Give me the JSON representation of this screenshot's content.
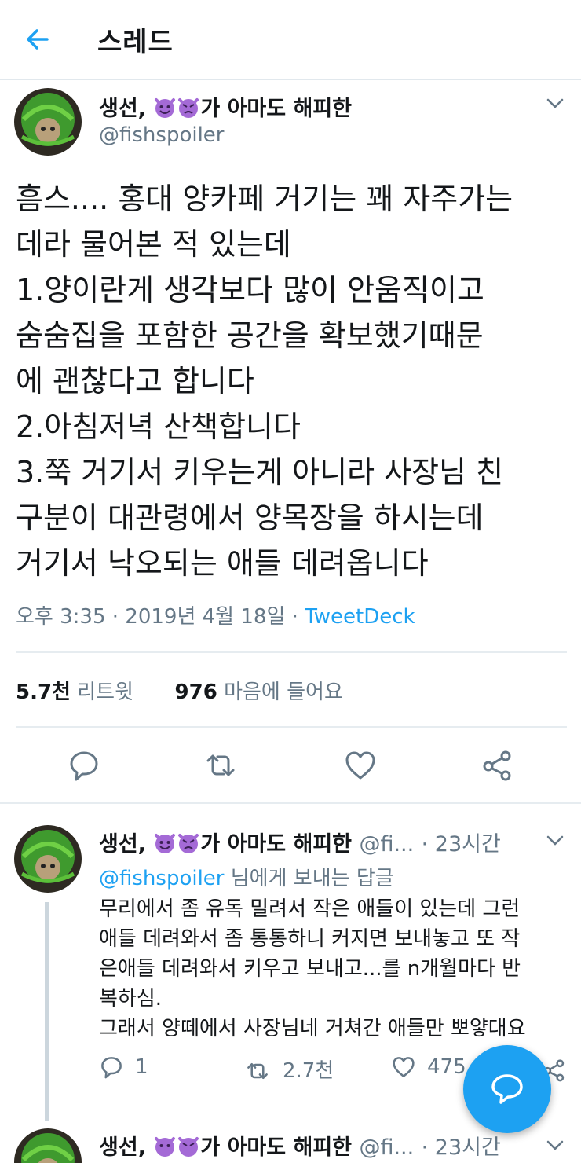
{
  "header": {
    "title": "스레드"
  },
  "tweet": {
    "author_name": "생선,",
    "author_name_suffix": "가 아마도 해피한",
    "handle": "@fishspoiler",
    "text": "흠스.... 홍대 양카페 거기는 꽤 자주가는\n데라 물어본 적 있는데\n1.양이란게 생각보다 많이 안움직이고\n숨숨집을 포함한 공간을 확보했기때문\n에 괜찮다고 합니다\n2.아침저녁 산책합니다\n3.쭉 거기서 키우는게 아니라 사장님 친\n구분이 대관령에서 양목장을 하시는데\n거기서 낙오되는 애들 데려옵니다",
    "time": "오후 3:35 · 2019년 4월 18일 · ",
    "source": "TweetDeck",
    "retweet_count": "5.7천",
    "retweet_label": "리트윗",
    "like_count": "976",
    "like_label": "마음에 들어요"
  },
  "reply": {
    "author_name": "생선,",
    "author_name_suffix": "가 아마도 해피한",
    "handle": "@fi...",
    "time": "· 23시간",
    "replying_to": "@fishspoiler",
    "replying_suffix": " 님에게 보내는 답글",
    "text": "무리에서 좀 유독 밀려서 작은 애들이 있는데 그런\n애들 데려와서 좀 통통하니 커지면 보내놓고 또 작\n은애들 데려와서 키우고 보내고...를 n개월마다 반\n복하심.\n그래서 양떼에서 사장님네 거쳐간 애들만 뽀얗대요",
    "reply_count": "1",
    "retweet_count": "2.7천",
    "like_count": "475"
  },
  "reply2": {
    "author_name": "생선,",
    "author_name_suffix": "가 아마도 해피한",
    "handle": "@fi...",
    "time": "· 23시간"
  },
  "colors": {
    "accent": "#1da1f2",
    "muted": "#657786",
    "text": "#14171a",
    "devil": "#a46ad6"
  }
}
